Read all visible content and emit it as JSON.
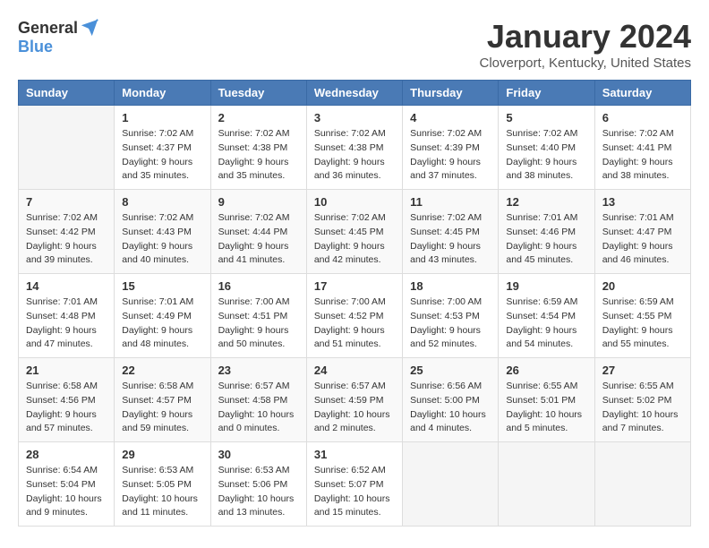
{
  "logo": {
    "general": "General",
    "blue": "Blue"
  },
  "title": "January 2024",
  "location": "Cloverport, Kentucky, United States",
  "days_of_week": [
    "Sunday",
    "Monday",
    "Tuesday",
    "Wednesday",
    "Thursday",
    "Friday",
    "Saturday"
  ],
  "weeks": [
    [
      {
        "day": "",
        "sunrise": "",
        "sunset": "",
        "daylight": ""
      },
      {
        "day": "1",
        "sunrise": "Sunrise: 7:02 AM",
        "sunset": "Sunset: 4:37 PM",
        "daylight": "Daylight: 9 hours and 35 minutes."
      },
      {
        "day": "2",
        "sunrise": "Sunrise: 7:02 AM",
        "sunset": "Sunset: 4:38 PM",
        "daylight": "Daylight: 9 hours and 35 minutes."
      },
      {
        "day": "3",
        "sunrise": "Sunrise: 7:02 AM",
        "sunset": "Sunset: 4:38 PM",
        "daylight": "Daylight: 9 hours and 36 minutes."
      },
      {
        "day": "4",
        "sunrise": "Sunrise: 7:02 AM",
        "sunset": "Sunset: 4:39 PM",
        "daylight": "Daylight: 9 hours and 37 minutes."
      },
      {
        "day": "5",
        "sunrise": "Sunrise: 7:02 AM",
        "sunset": "Sunset: 4:40 PM",
        "daylight": "Daylight: 9 hours and 38 minutes."
      },
      {
        "day": "6",
        "sunrise": "Sunrise: 7:02 AM",
        "sunset": "Sunset: 4:41 PM",
        "daylight": "Daylight: 9 hours and 38 minutes."
      }
    ],
    [
      {
        "day": "7",
        "sunrise": "Sunrise: 7:02 AM",
        "sunset": "Sunset: 4:42 PM",
        "daylight": "Daylight: 9 hours and 39 minutes."
      },
      {
        "day": "8",
        "sunrise": "Sunrise: 7:02 AM",
        "sunset": "Sunset: 4:43 PM",
        "daylight": "Daylight: 9 hours and 40 minutes."
      },
      {
        "day": "9",
        "sunrise": "Sunrise: 7:02 AM",
        "sunset": "Sunset: 4:44 PM",
        "daylight": "Daylight: 9 hours and 41 minutes."
      },
      {
        "day": "10",
        "sunrise": "Sunrise: 7:02 AM",
        "sunset": "Sunset: 4:45 PM",
        "daylight": "Daylight: 9 hours and 42 minutes."
      },
      {
        "day": "11",
        "sunrise": "Sunrise: 7:02 AM",
        "sunset": "Sunset: 4:45 PM",
        "daylight": "Daylight: 9 hours and 43 minutes."
      },
      {
        "day": "12",
        "sunrise": "Sunrise: 7:01 AM",
        "sunset": "Sunset: 4:46 PM",
        "daylight": "Daylight: 9 hours and 45 minutes."
      },
      {
        "day": "13",
        "sunrise": "Sunrise: 7:01 AM",
        "sunset": "Sunset: 4:47 PM",
        "daylight": "Daylight: 9 hours and 46 minutes."
      }
    ],
    [
      {
        "day": "14",
        "sunrise": "Sunrise: 7:01 AM",
        "sunset": "Sunset: 4:48 PM",
        "daylight": "Daylight: 9 hours and 47 minutes."
      },
      {
        "day": "15",
        "sunrise": "Sunrise: 7:01 AM",
        "sunset": "Sunset: 4:49 PM",
        "daylight": "Daylight: 9 hours and 48 minutes."
      },
      {
        "day": "16",
        "sunrise": "Sunrise: 7:00 AM",
        "sunset": "Sunset: 4:51 PM",
        "daylight": "Daylight: 9 hours and 50 minutes."
      },
      {
        "day": "17",
        "sunrise": "Sunrise: 7:00 AM",
        "sunset": "Sunset: 4:52 PM",
        "daylight": "Daylight: 9 hours and 51 minutes."
      },
      {
        "day": "18",
        "sunrise": "Sunrise: 7:00 AM",
        "sunset": "Sunset: 4:53 PM",
        "daylight": "Daylight: 9 hours and 52 minutes."
      },
      {
        "day": "19",
        "sunrise": "Sunrise: 6:59 AM",
        "sunset": "Sunset: 4:54 PM",
        "daylight": "Daylight: 9 hours and 54 minutes."
      },
      {
        "day": "20",
        "sunrise": "Sunrise: 6:59 AM",
        "sunset": "Sunset: 4:55 PM",
        "daylight": "Daylight: 9 hours and 55 minutes."
      }
    ],
    [
      {
        "day": "21",
        "sunrise": "Sunrise: 6:58 AM",
        "sunset": "Sunset: 4:56 PM",
        "daylight": "Daylight: 9 hours and 57 minutes."
      },
      {
        "day": "22",
        "sunrise": "Sunrise: 6:58 AM",
        "sunset": "Sunset: 4:57 PM",
        "daylight": "Daylight: 9 hours and 59 minutes."
      },
      {
        "day": "23",
        "sunrise": "Sunrise: 6:57 AM",
        "sunset": "Sunset: 4:58 PM",
        "daylight": "Daylight: 10 hours and 0 minutes."
      },
      {
        "day": "24",
        "sunrise": "Sunrise: 6:57 AM",
        "sunset": "Sunset: 4:59 PM",
        "daylight": "Daylight: 10 hours and 2 minutes."
      },
      {
        "day": "25",
        "sunrise": "Sunrise: 6:56 AM",
        "sunset": "Sunset: 5:00 PM",
        "daylight": "Daylight: 10 hours and 4 minutes."
      },
      {
        "day": "26",
        "sunrise": "Sunrise: 6:55 AM",
        "sunset": "Sunset: 5:01 PM",
        "daylight": "Daylight: 10 hours and 5 minutes."
      },
      {
        "day": "27",
        "sunrise": "Sunrise: 6:55 AM",
        "sunset": "Sunset: 5:02 PM",
        "daylight": "Daylight: 10 hours and 7 minutes."
      }
    ],
    [
      {
        "day": "28",
        "sunrise": "Sunrise: 6:54 AM",
        "sunset": "Sunset: 5:04 PM",
        "daylight": "Daylight: 10 hours and 9 minutes."
      },
      {
        "day": "29",
        "sunrise": "Sunrise: 6:53 AM",
        "sunset": "Sunset: 5:05 PM",
        "daylight": "Daylight: 10 hours and 11 minutes."
      },
      {
        "day": "30",
        "sunrise": "Sunrise: 6:53 AM",
        "sunset": "Sunset: 5:06 PM",
        "daylight": "Daylight: 10 hours and 13 minutes."
      },
      {
        "day": "31",
        "sunrise": "Sunrise: 6:52 AM",
        "sunset": "Sunset: 5:07 PM",
        "daylight": "Daylight: 10 hours and 15 minutes."
      },
      {
        "day": "",
        "sunrise": "",
        "sunset": "",
        "daylight": ""
      },
      {
        "day": "",
        "sunrise": "",
        "sunset": "",
        "daylight": ""
      },
      {
        "day": "",
        "sunrise": "",
        "sunset": "",
        "daylight": ""
      }
    ]
  ]
}
